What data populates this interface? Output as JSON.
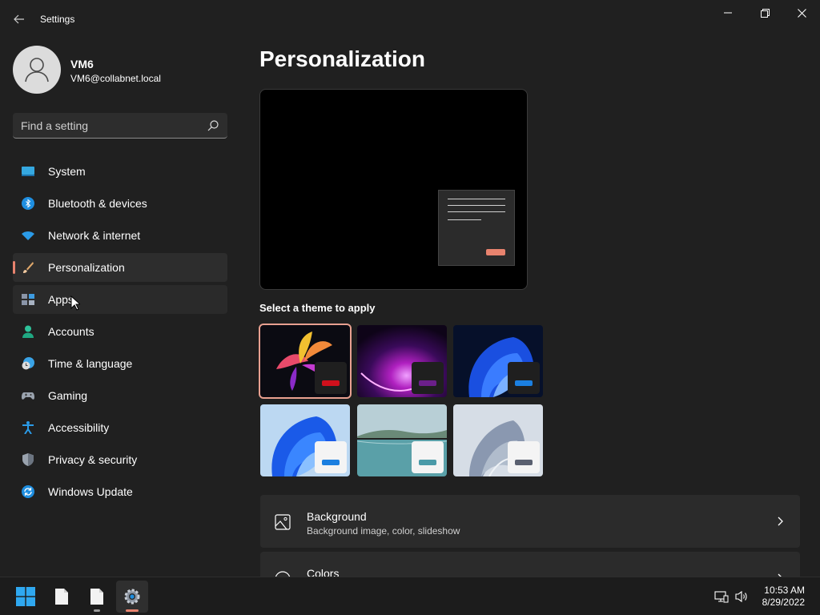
{
  "window": {
    "title": "Settings"
  },
  "user": {
    "name": "VM6",
    "email": "VM6@collabnet.local"
  },
  "search": {
    "placeholder": "Find a setting",
    "value": ""
  },
  "sidebar": {
    "items": [
      {
        "label": "System",
        "icon": "monitor-icon",
        "active": false
      },
      {
        "label": "Bluetooth & devices",
        "icon": "bluetooth-icon",
        "active": false
      },
      {
        "label": "Network & internet",
        "icon": "wifi-icon",
        "active": false
      },
      {
        "label": "Personalization",
        "icon": "paintbrush-icon",
        "active": true
      },
      {
        "label": "Apps",
        "icon": "apps-icon",
        "active": false
      },
      {
        "label": "Accounts",
        "icon": "person-icon",
        "active": false
      },
      {
        "label": "Time & language",
        "icon": "clock-globe-icon",
        "active": false
      },
      {
        "label": "Gaming",
        "icon": "gamepad-icon",
        "active": false
      },
      {
        "label": "Accessibility",
        "icon": "accessibility-icon",
        "active": false
      },
      {
        "label": "Privacy & security",
        "icon": "shield-icon",
        "active": false
      },
      {
        "label": "Windows Update",
        "icon": "update-icon",
        "active": false
      }
    ]
  },
  "main": {
    "title": "Personalization",
    "theme_section_label": "Select a theme to apply",
    "themes": [
      {
        "name": "glow-flower",
        "accent": "#d0101c",
        "selected": true
      },
      {
        "name": "purple-glow",
        "accent": "#6b1f8a",
        "selected": false
      },
      {
        "name": "dark-bloom",
        "accent": "#1b7fe0",
        "selected": false
      },
      {
        "name": "light-bloom",
        "accent": "#1b7fe0",
        "selected": false
      },
      {
        "name": "lake",
        "accent": "#4a9aa8",
        "selected": false
      },
      {
        "name": "silver-flow",
        "accent": "#5a6070",
        "selected": false
      }
    ],
    "cards": [
      {
        "title": "Background",
        "subtitle": "Background image, color, slideshow",
        "icon": "image-icon"
      },
      {
        "title": "Colors",
        "subtitle": "",
        "icon": "palette-icon"
      }
    ]
  },
  "taskbar": {
    "time": "10:53 AM",
    "date": "8/29/2022"
  },
  "colors": {
    "accent": "#e8836e",
    "background": "#202020",
    "card": "#2b2b2b"
  }
}
